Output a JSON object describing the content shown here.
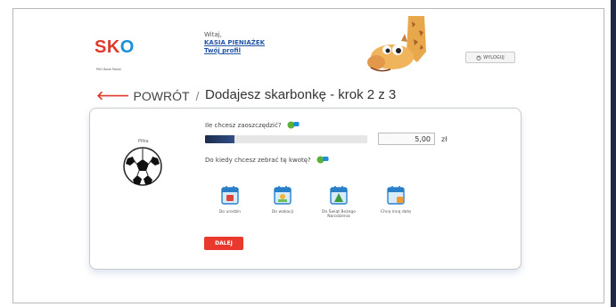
{
  "brand": {
    "logo": "SKO",
    "logo_sub": "PKO Bank Polski"
  },
  "greeting": {
    "hello": "Witaj,",
    "user": "KASIA PIENIĄŻEK",
    "profile_link": "Twój profil"
  },
  "logout": {
    "label": "WYLOGUJ",
    "icon": "power-icon"
  },
  "nav": {
    "back_label": "POWRÓT",
    "separator": "/"
  },
  "step": {
    "title": "Dodajesz skarbonkę - krok 2 z 3"
  },
  "piggy": {
    "label": "Piłka",
    "icon": "soccer-ball-icon"
  },
  "amount_question": "Ile chcesz zaoszczędzić?",
  "progress": {
    "fraction": 0.18
  },
  "amount": {
    "value": "5,00",
    "currency": "zł"
  },
  "date_question": "Do kiedy chcesz zebrać tę kwotę?",
  "date_options": [
    {
      "label": "Do urodzin",
      "icon": "birthday-calendar-icon"
    },
    {
      "label": "Do wakacji",
      "icon": "vacation-calendar-icon"
    },
    {
      "label": "Do Świąt Bożego Narodzenia",
      "icon": "christmas-calendar-icon"
    },
    {
      "label": "Chcę inną datę",
      "icon": "custom-date-calendar-icon"
    }
  ],
  "next_button": "DALEJ",
  "colors": {
    "accent_red": "#e8392c",
    "link_blue": "#2456a8",
    "progress_dark": "#1c2d4f"
  }
}
